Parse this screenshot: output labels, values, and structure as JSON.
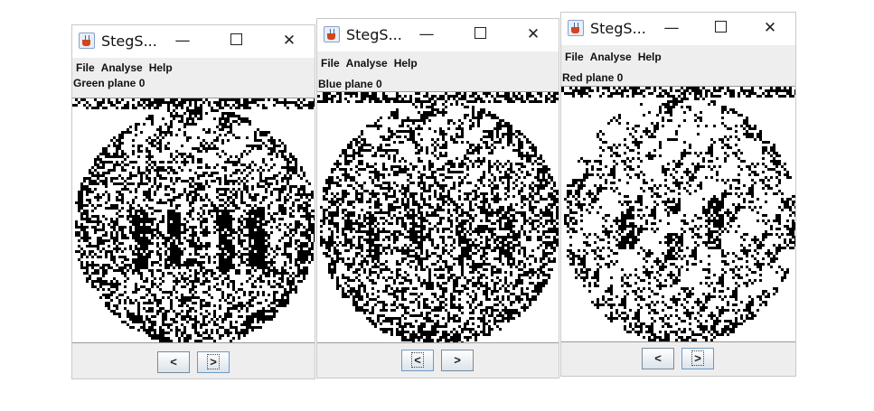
{
  "windows": [
    {
      "id": "green",
      "title": "StegS...",
      "menu": [
        "File",
        "Analyse",
        "Help"
      ],
      "plane_label": "Green plane 0",
      "controls": {
        "minimize": "—",
        "maximize": "",
        "close": "✕"
      },
      "nav": {
        "prev": "<",
        "next": ">"
      },
      "focused_button": "next"
    },
    {
      "id": "blue",
      "title": "StegS...",
      "menu": [
        "File",
        "Analyse",
        "Help"
      ],
      "plane_label": "Blue plane 0",
      "controls": {
        "minimize": "—",
        "maximize": "",
        "close": "✕"
      },
      "nav": {
        "prev": "<",
        "next": ">"
      },
      "focused_button": "prev"
    },
    {
      "id": "red",
      "title": "StegS...",
      "menu": [
        "File",
        "Analyse",
        "Help"
      ],
      "plane_label": "Red plane 0",
      "controls": {
        "minimize": "—",
        "maximize": "",
        "close": "✕"
      },
      "nav": {
        "prev": "<",
        "next": ">"
      },
      "focused_button": "next"
    }
  ],
  "colors": {
    "window_bg": "#eeeeee",
    "titlebar_bg": "#ffffff",
    "pixel_on": "#000000",
    "pixel_off": "#ffffff"
  }
}
